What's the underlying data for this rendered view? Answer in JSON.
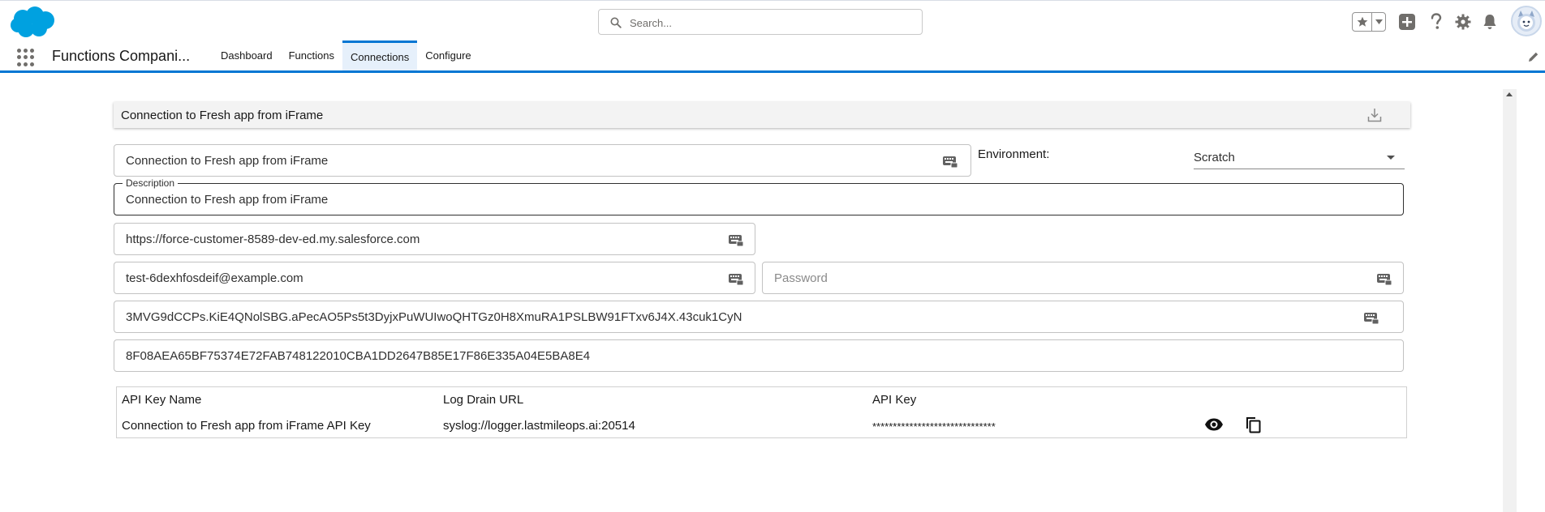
{
  "header": {
    "search_placeholder": "Search..."
  },
  "context_bar": {
    "app_name": "Functions Compani...",
    "tabs": [
      {
        "label": "Dashboard",
        "active": false
      },
      {
        "label": "Functions",
        "active": false
      },
      {
        "label": "Connections",
        "active": true
      },
      {
        "label": "Configure",
        "active": false
      }
    ]
  },
  "card": {
    "title": "Connection to Fresh app from iFrame"
  },
  "form": {
    "name_value": "Connection to Fresh app from iFrame",
    "environment_label": "Environment:",
    "environment_value": "Scratch",
    "description_label": "Description",
    "description_value": "Connection to Fresh app from iFrame",
    "instance_url_value": "https://force-customer-8589-dev-ed.my.salesforce.com",
    "username_value": "test-6dexhfosdeif@example.com",
    "password_placeholder": "Password",
    "consumer_key_value": "3MVG9dCCPs.KiE4QNolSBG.aPecAO5Ps5t3DyjxPuWUIwoQHTGz0H8XmuRA1PSLBW91FTxv6J4X.43cuk1CyN",
    "secret_value": "8F08AEA65BF75374E72FAB748122010CBA1DD2647B85E17F86E335A04E5BA8E4"
  },
  "api_keys": {
    "headers": [
      "API Key Name",
      "Log Drain URL",
      "API Key"
    ],
    "rows": [
      {
        "name": "Connection to Fresh app from iFrame API Key",
        "log_drain_url": "syslog://logger.lastmileops.ai:20514",
        "api_key": "******************************"
      }
    ]
  },
  "colors": {
    "brand_blue": "#0176d3",
    "salesforce_cloud": "#00a1e0",
    "active_tab_bg": "#e6f0fb"
  },
  "icons": [
    "salesforce-logo",
    "search-icon",
    "star-icon",
    "chevron-down-icon",
    "add-icon",
    "help-icon",
    "gear-icon",
    "bell-icon",
    "avatar",
    "app-launcher-icon",
    "pencil-icon",
    "download-icon",
    "keyboard-icon",
    "eye-icon",
    "copy-icon"
  ]
}
